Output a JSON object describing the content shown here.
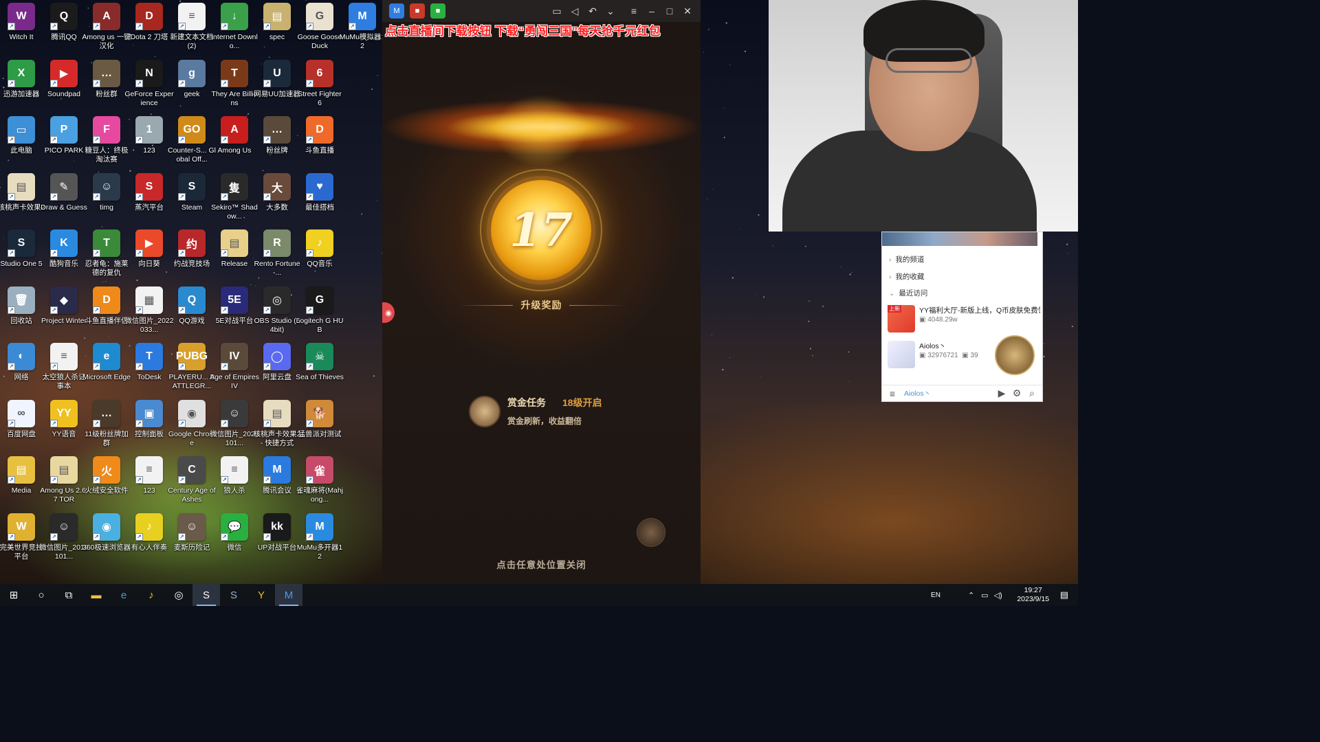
{
  "desktop": {
    "icons": [
      {
        "label": "Witch It",
        "color": "#7a2a8a",
        "glyph": "W"
      },
      {
        "label": "腾讯QQ",
        "color": "#1b1b1b",
        "glyph": "Q"
      },
      {
        "label": "Among us 一键汉化",
        "color": "#8a2b2b",
        "glyph": "A"
      },
      {
        "label": "Dota 2 刀塔",
        "color": "#a8271e",
        "glyph": "D"
      },
      {
        "label": "新建文本文档 (2)",
        "color": "#f2f2f2",
        "glyph": "≡"
      },
      {
        "label": "Internet Downlo...",
        "color": "#3aa04a",
        "glyph": "↓"
      },
      {
        "label": "spec",
        "color": "#c9b170",
        "glyph": "▤"
      },
      {
        "label": "Goose Goose Duck",
        "color": "#e9e2d0",
        "glyph": "G"
      },
      {
        "label": "MuMu模拟器12",
        "color": "#2f7de1",
        "glyph": "M"
      },
      {
        "label": "迅游加速器",
        "color": "#2e9b46",
        "glyph": "X"
      },
      {
        "label": "Soundpad",
        "color": "#d62a2a",
        "glyph": "▶"
      },
      {
        "label": "粉丝群",
        "color": "#6a5a44",
        "glyph": "…"
      },
      {
        "label": "GeForce Experience",
        "color": "#1a1a1a",
        "glyph": "N"
      },
      {
        "label": "geek",
        "color": "#5a7aa0",
        "glyph": "g"
      },
      {
        "label": "They Are Billions",
        "color": "#7a3a1a",
        "glyph": "T"
      },
      {
        "label": "网易UU加速器",
        "color": "#1a2a3a",
        "glyph": "U"
      },
      {
        "label": "Street Fighter 6",
        "color": "#b8302a",
        "glyph": "6"
      },
      {
        "label": "此电脑",
        "color": "#3d8fd6",
        "glyph": "▭"
      },
      {
        "label": "PICO PARK",
        "color": "#4aa0e0",
        "glyph": "P"
      },
      {
        "label": "糖豆人：终极淘汰赛",
        "color": "#e64aa0",
        "glyph": "F"
      },
      {
        "label": "123",
        "color": "#9aa8b0",
        "glyph": "1"
      },
      {
        "label": "Counter-S... Global Off...",
        "color": "#d08a1a",
        "glyph": "GO"
      },
      {
        "label": "Among Us",
        "color": "#c81e1e",
        "glyph": "A"
      },
      {
        "label": "粉丝牌",
        "color": "#5a4a3a",
        "glyph": "…"
      },
      {
        "label": "斗鱼直播",
        "color": "#ef6a2a",
        "glyph": "D"
      },
      {
        "label": "核桃声卡效果2",
        "color": "#e8dcc0",
        "glyph": "▤"
      },
      {
        "label": "Draw & Guess",
        "color": "#555555",
        "glyph": "✎"
      },
      {
        "label": "timg",
        "color": "#2a3a4a",
        "glyph": "☺"
      },
      {
        "label": "蒸汽平台",
        "color": "#c8282a",
        "glyph": "S"
      },
      {
        "label": "Steam",
        "color": "#1b2838",
        "glyph": "S"
      },
      {
        "label": "Sekiro™ Shadow...",
        "color": "#2a2a2a",
        "glyph": "隻"
      },
      {
        "label": "大多数",
        "color": "#6a4a3a",
        "glyph": "大"
      },
      {
        "label": "最佳搭档",
        "color": "#2a6ad0",
        "glyph": "♥"
      },
      {
        "label": "Studio One 5",
        "color": "#1a2a3a",
        "glyph": "S"
      },
      {
        "label": "酷狗音乐",
        "color": "#2a8ae0",
        "glyph": "K"
      },
      {
        "label": "忍者龟：施莱德的复仇",
        "color": "#3a8a3a",
        "glyph": "T"
      },
      {
        "label": "向日葵",
        "color": "#ea4a2a",
        "glyph": "▶"
      },
      {
        "label": "约战竞技场",
        "color": "#b8282a",
        "glyph": "约"
      },
      {
        "label": "Release",
        "color": "#e8d08a",
        "glyph": "▤"
      },
      {
        "label": "Rento Fortune -...",
        "color": "#7a8a6a",
        "glyph": "R"
      },
      {
        "label": "QQ音乐",
        "color": "#f0d020",
        "glyph": "♪"
      },
      {
        "label": "回收站",
        "color": "#9ab0c0",
        "glyph": "🗑"
      },
      {
        "label": "Project Winter",
        "color": "#2a2a4a",
        "glyph": "◆"
      },
      {
        "label": "斗鱼直播伴侣",
        "color": "#ef8a1a",
        "glyph": "D"
      },
      {
        "label": "微信图片_2022033...",
        "color": "#f2f2f2",
        "glyph": "▦"
      },
      {
        "label": "QQ游戏",
        "color": "#2a8ad0",
        "glyph": "Q"
      },
      {
        "label": "5E对战平台",
        "color": "#2a2a7a",
        "glyph": "5E"
      },
      {
        "label": "OBS Studio (64bit)",
        "color": "#2a2a2a",
        "glyph": "◎"
      },
      {
        "label": "Logitech G HUB",
        "color": "#1a1a1a",
        "glyph": "G"
      },
      {
        "label": "网络",
        "color": "#3a8ad6",
        "glyph": "◐"
      },
      {
        "label": "太空狼人杀记事本",
        "color": "#f2f2f2",
        "glyph": "≡"
      },
      {
        "label": "Microsoft Edge",
        "color": "#1e8ad0",
        "glyph": "e"
      },
      {
        "label": "ToDesk",
        "color": "#2a7ae0",
        "glyph": "T"
      },
      {
        "label": "PLAYERU... BATTLEGR...",
        "color": "#d8a02a",
        "glyph": "PUBG"
      },
      {
        "label": "Age of Empires IV",
        "color": "#5a4a3a",
        "glyph": "IV"
      },
      {
        "label": "阿里云盘",
        "color": "#5a6af0",
        "glyph": "◯"
      },
      {
        "label": "Sea of Thieves",
        "color": "#1a8a5a",
        "glyph": "☠"
      },
      {
        "label": "百度网盘",
        "color": "#f0f4ff",
        "glyph": "∞"
      },
      {
        "label": "YY语音",
        "color": "#f0c020",
        "glyph": "YY"
      },
      {
        "label": "11级粉丝牌加群",
        "color": "#4a3a2a",
        "glyph": "…"
      },
      {
        "label": "控制面板",
        "color": "#4a8ad0",
        "glyph": "▣"
      },
      {
        "label": "Google Chrome",
        "color": "#e0e0e0",
        "glyph": "◉"
      },
      {
        "label": "微信图片_2020101...",
        "color": "#3a3a3a",
        "glyph": "☺"
      },
      {
        "label": "核桃声卡效果2 - 快捷方式",
        "color": "#e8dcc0",
        "glyph": "▤"
      },
      {
        "label": "猛兽派对测试",
        "color": "#d08a3a",
        "glyph": "🐕"
      },
      {
        "label": "Media",
        "color": "#e8c040",
        "glyph": "▤"
      },
      {
        "label": "Among Us 2.6.7 TOR",
        "color": "#e8d8a0",
        "glyph": "▤"
      },
      {
        "label": "火绒安全软件",
        "color": "#f08a1a",
        "glyph": "火"
      },
      {
        "label": "123",
        "color": "#f2f2f2",
        "glyph": "≡"
      },
      {
        "label": "Century Age of Ashes",
        "color": "#4a4a4a",
        "glyph": "C"
      },
      {
        "label": "狼人杀",
        "color": "#f2f2f2",
        "glyph": "≡"
      },
      {
        "label": "腾讯会议",
        "color": "#2a7ae0",
        "glyph": "M"
      },
      {
        "label": "雀魂麻将(Mahjong...",
        "color": "#c84a6a",
        "glyph": "雀"
      },
      {
        "label": "完美世界竞技平台",
        "color": "#e0b030",
        "glyph": "W"
      },
      {
        "label": "微信图片_2018101...",
        "color": "#2a2a2a",
        "glyph": "☺"
      },
      {
        "label": "360极速浏览器",
        "color": "#4ab0e0",
        "glyph": "◉"
      },
      {
        "label": "有心人伴奏",
        "color": "#e8d020",
        "glyph": "♪"
      },
      {
        "label": "麦斯历险记",
        "color": "#6a5a4a",
        "glyph": "☺"
      },
      {
        "label": "微信",
        "color": "#2ab040",
        "glyph": "💬"
      },
      {
        "label": "UP对战平台",
        "color": "#1a1a1a",
        "glyph": "kk"
      },
      {
        "label": "MuMu多开器12",
        "color": "#2a8ae0",
        "glyph": "M"
      }
    ]
  },
  "emulator": {
    "banner": "点击直播间下载按钮 下载“勇闯三国”每天抢千元红包",
    "level": "17",
    "reward_title": "升级奖励",
    "bounty": {
      "title": "赏金任务",
      "unlock": "18级开启",
      "desc": "赏金刷新，收益翻倍"
    },
    "close_hint": "点击任意处位置关闭",
    "titlebar": {
      "tab_colors": [
        "#2f7de1",
        "#c83a2a",
        "#2ab040"
      ]
    }
  },
  "yy_panel": {
    "menu": [
      {
        "label": "我的频道",
        "chev": "›"
      },
      {
        "label": "我的收藏",
        "chev": "›"
      },
      {
        "label": "最近访问",
        "chev": "⌄"
      }
    ],
    "channels": [
      {
        "name": "YY福利大厅-新版上线，Q币皮肤免费领",
        "meta": "4048.29w",
        "badge": "上新"
      },
      {
        "name": "Aiolos丶",
        "meta": "32976721",
        "meta2": "39"
      }
    ],
    "user": "Aiolos丶"
  },
  "taskbar": {
    "lang": "EN",
    "time": "19:27",
    "date": "2023/9/15"
  }
}
